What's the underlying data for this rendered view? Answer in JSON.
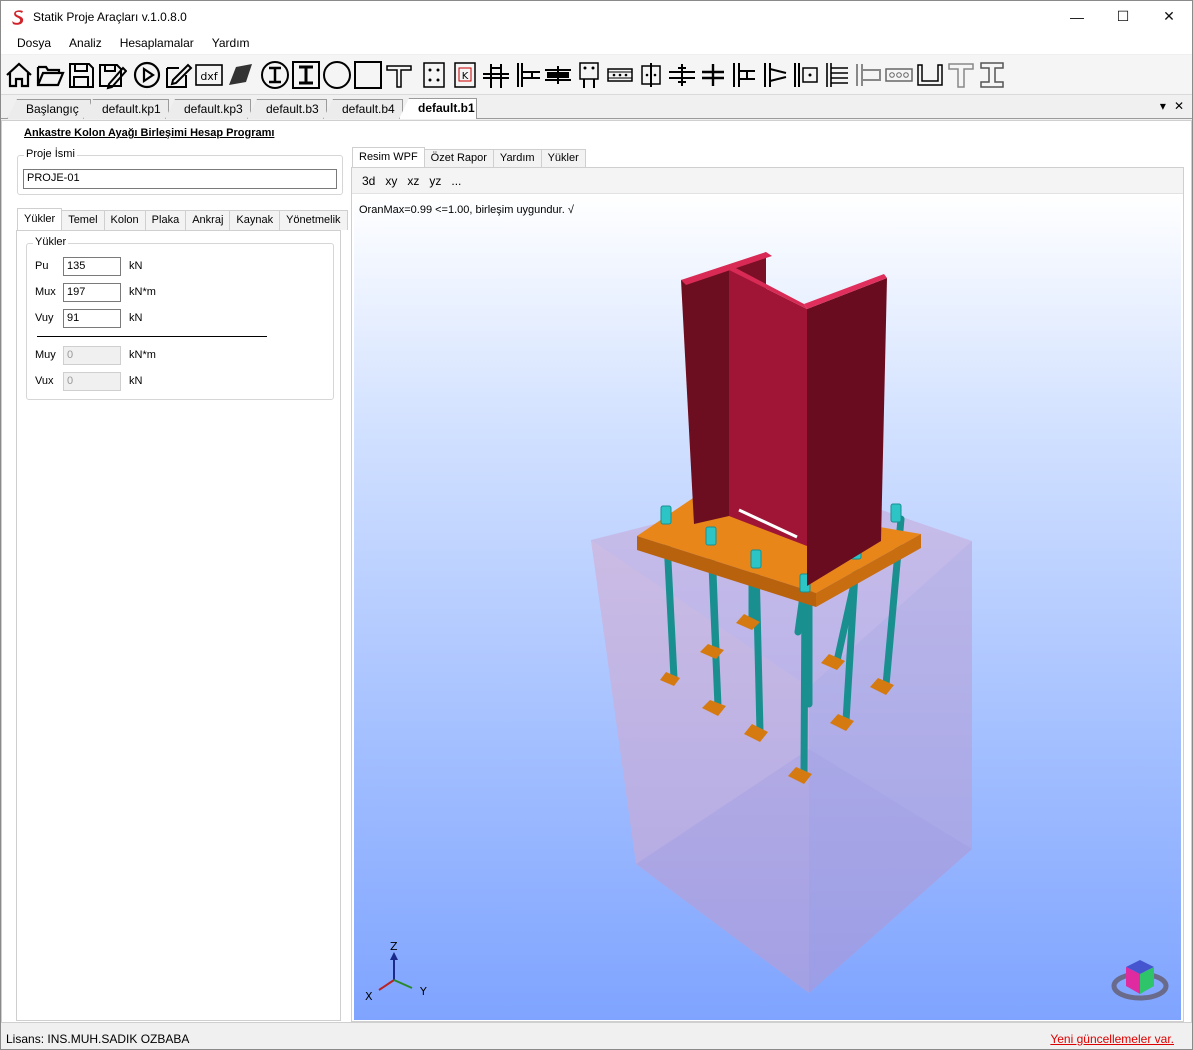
{
  "window": {
    "title": "Statik Proje Araçları v.1.0.8.0",
    "minimize": "—",
    "maximize": "☐",
    "close": "✕"
  },
  "menu": [
    "Dosya",
    "Analiz",
    "Hesaplamalar",
    "Yardım"
  ],
  "doc_tabs": [
    "Başlangıç",
    "default.kp1",
    "default.kp3",
    "default.b3",
    "default.b4",
    "default.b1"
  ],
  "doc_tab_controls": {
    "dropdown": "▾",
    "close": "✕"
  },
  "form": {
    "title": "Ankastre Kolon Ayağı Birleşimi Hesap Programı",
    "project_legend": "Proje İsmi",
    "project_name": "PROJE-01"
  },
  "left_tabs": [
    "Yükler",
    "Temel",
    "Kolon",
    "Plaka",
    "Ankraj",
    "Kaynak",
    "Yönetmelik"
  ],
  "loads": {
    "legend": "Yükler",
    "pu": {
      "label": "Pu",
      "value": "135",
      "unit": "kN"
    },
    "mux": {
      "label": "Mux",
      "value": "197",
      "unit": "kN*m"
    },
    "vuy": {
      "label": "Vuy",
      "value": "91",
      "unit": "kN"
    },
    "muy": {
      "label": "Muy",
      "value": "0",
      "unit": "kN*m"
    },
    "vux": {
      "label": "Vux",
      "value": "0",
      "unit": "kN"
    }
  },
  "right_tabs": [
    "Resim WPF",
    "Özet Rapor",
    "Yardım",
    "Yükler"
  ],
  "view_buttons": [
    "3d",
    "xy",
    "xz",
    "yz",
    "..."
  ],
  "viewport": {
    "ratio_text": "OranMax=0.99 <=1.00, birleşim uygundur. √",
    "axis_z": "Z",
    "axis_x": "X",
    "axis_y": "Y",
    "colors": {
      "column": "#b0183a",
      "plate": "#d57a10",
      "bolt": "#1fa6a6",
      "foundation": "#c9a7d8"
    }
  },
  "status": {
    "license": "Lisans: INS.MUH.SADIK OZBABA",
    "update": "Yeni güncellemeler var."
  }
}
